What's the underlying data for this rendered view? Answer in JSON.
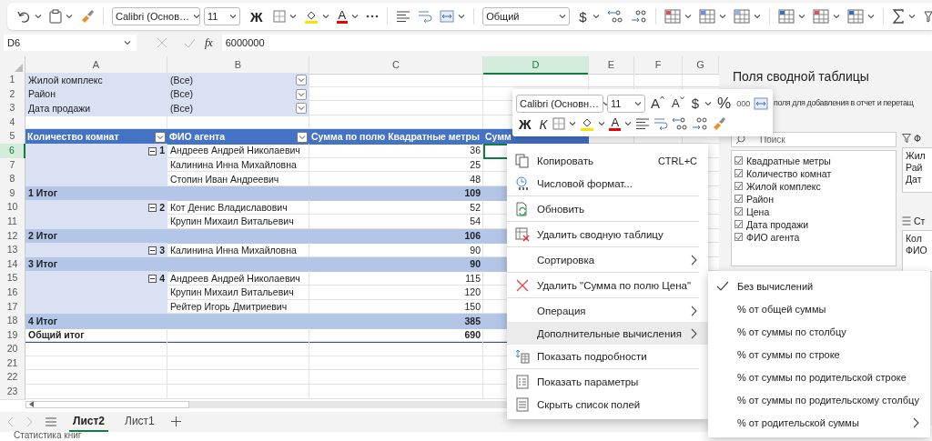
{
  "toolbar": {
    "font": "Calibri (Основ…",
    "font_size": "11",
    "bold": "Ж",
    "font_color": "A",
    "number_format": "Общий",
    "currency": "$"
  },
  "formula_bar": {
    "name_box": "D6",
    "function_label": "fx",
    "value": "6000000"
  },
  "columns": [
    {
      "label": "A",
      "selected": false
    },
    {
      "label": "B",
      "selected": false
    },
    {
      "label": "C",
      "selected": false
    },
    {
      "label": "D",
      "selected": true
    },
    {
      "label": "E",
      "selected": false
    },
    {
      "label": "F",
      "selected": false
    },
    {
      "label": "G",
      "selected": false
    }
  ],
  "rows": [
    {
      "n": "1",
      "kind": "filter",
      "selected": false,
      "field": "Жилой комплекс",
      "value": "(Все)"
    },
    {
      "n": "2",
      "kind": "filter",
      "selected": false,
      "field": "Район",
      "value": "(Все)"
    },
    {
      "n": "3",
      "kind": "filter",
      "selected": false,
      "field": "Дата продажи",
      "value": "(Все)"
    },
    {
      "n": "4",
      "kind": "empty",
      "selected": false
    },
    {
      "n": "5",
      "kind": "header",
      "selected": false,
      "cells": [
        {
          "label": "Количество комнат",
          "filter": true
        },
        {
          "label": "ФИО агента",
          "filter": true
        },
        {
          "label": "Сумма по полю Квадратные метры",
          "filter": false
        },
        {
          "label": "Сумм",
          "filter": false
        }
      ]
    },
    {
      "n": "6",
      "kind": "item",
      "selected": true,
      "group": "1",
      "name": "Андреев Андрей Николаевич",
      "value": "36"
    },
    {
      "n": "7",
      "kind": "item",
      "selected": false,
      "name": "Калинина Инна Михайловна",
      "value": "25"
    },
    {
      "n": "8",
      "kind": "item",
      "selected": false,
      "name": "Стопин Иван Андреевич",
      "value": "48"
    },
    {
      "n": "9",
      "kind": "subtotal",
      "selected": false,
      "label": "1 Итог",
      "value": "109"
    },
    {
      "n": "10",
      "kind": "item",
      "selected": false,
      "group": "2",
      "name": "Кот Денис Владиславович",
      "value": "52"
    },
    {
      "n": "11",
      "kind": "item",
      "selected": false,
      "name": "Крупин Михаил Витальевич",
      "value": "54"
    },
    {
      "n": "12",
      "kind": "subtotal",
      "selected": false,
      "label": "2 Итог",
      "value": "106"
    },
    {
      "n": "13",
      "kind": "item",
      "selected": false,
      "group": "3",
      "name": "Калинина Инна Михайловна",
      "value": "90"
    },
    {
      "n": "14",
      "kind": "subtotal",
      "selected": false,
      "label": "3 Итог",
      "value": "90"
    },
    {
      "n": "15",
      "kind": "item",
      "selected": false,
      "group": "4",
      "name": "Андреев Андрей Николаевич",
      "value": "115"
    },
    {
      "n": "16",
      "kind": "item",
      "selected": false,
      "name": "Крупин Михаил Витальевич",
      "value": "120"
    },
    {
      "n": "17",
      "kind": "item",
      "selected": false,
      "name": "Рейтер Игорь Дмитриевич",
      "value": "150"
    },
    {
      "n": "18",
      "kind": "subtotal",
      "selected": false,
      "label": "4 Итог",
      "value": "385"
    },
    {
      "n": "19",
      "kind": "grand",
      "selected": false,
      "label": "Общий итог",
      "value": "690"
    },
    {
      "n": "20",
      "kind": "empty",
      "selected": false
    },
    {
      "n": "21",
      "kind": "empty",
      "selected": false
    },
    {
      "n": "22",
      "kind": "empty",
      "selected": false
    },
    {
      "n": "23",
      "kind": "empty",
      "selected": false
    }
  ],
  "sheet_tabs": [
    {
      "label": "Лист2",
      "selected": true
    },
    {
      "label": "Лист1",
      "selected": false
    }
  ],
  "status_bar": "Статистика книг",
  "pivot_panel": {
    "title": "Поля сводной таблицы",
    "hint": "поля для добавления в отчет и перетащ",
    "search_placeholder": "Поиск",
    "fields": [
      {
        "label": "Квадратные метры",
        "checked": true
      },
      {
        "label": "Количество комнат",
        "checked": true
      },
      {
        "label": "Жилой комплекс",
        "checked": true
      },
      {
        "label": "Район",
        "checked": true
      },
      {
        "label": "Цена",
        "checked": true
      },
      {
        "label": "Дата продажи",
        "checked": true
      },
      {
        "label": "ФИО агента",
        "checked": true
      }
    ],
    "filters": {
      "title": "Ф",
      "items": [
        "Жил",
        "Рай",
        "Дат"
      ]
    },
    "rows_area": {
      "title": "Ст",
      "items": [
        "Кол",
        "ФИО"
      ]
    }
  },
  "mini_toolbar": {
    "font": "Calibri (Основн…",
    "font_size": "11",
    "grow_font": "A",
    "shrink_font": "A",
    "currency": "$",
    "percent": "%",
    "thousands": "000",
    "bold": "Ж",
    "italic": "К",
    "font_color": "A"
  },
  "context_menu": {
    "groups": [
      [
        {
          "label": "Копировать",
          "shortcut": "CTRL+C",
          "submenu": false,
          "selected": false
        },
        {
          "label": "Числовой формат...",
          "submenu": false,
          "selected": false
        }
      ],
      [
        {
          "label": "Обновить",
          "submenu": false,
          "selected": false
        }
      ],
      [
        {
          "label": "Удалить сводную таблицу",
          "submenu": false,
          "selected": false
        }
      ],
      [
        {
          "label": "Сортировка",
          "submenu": true,
          "selected": false
        }
      ],
      [
        {
          "label": "Удалить \"Сумма по полю Цена\"",
          "submenu": false,
          "selected": false
        }
      ],
      [
        {
          "label": "Операция",
          "submenu": true,
          "selected": false
        },
        {
          "label": "Дополнительные вычисления",
          "submenu": true,
          "selected": true
        },
        {
          "label": "Показать подробности",
          "submenu": false,
          "selected": false
        }
      ],
      [
        {
          "label": "Показать параметры",
          "submenu": false,
          "selected": false
        },
        {
          "label": "Скрыть список полей",
          "submenu": false,
          "selected": false
        }
      ]
    ]
  },
  "submenu": {
    "items": [
      {
        "label": "Без вычислений",
        "checked": true,
        "submenu": false
      },
      {
        "label": "% от общей суммы",
        "checked": false,
        "submenu": false
      },
      {
        "label": "% от суммы по столбцу",
        "checked": false,
        "submenu": false
      },
      {
        "label": "% от суммы по строке",
        "checked": false,
        "submenu": false
      },
      {
        "label": "% от суммы по родительской строке",
        "checked": false,
        "submenu": false
      },
      {
        "label": "% от суммы по родительскому столбцу",
        "checked": false,
        "submenu": false
      },
      {
        "label": "% от родительской суммы",
        "checked": false,
        "submenu": true
      }
    ]
  }
}
